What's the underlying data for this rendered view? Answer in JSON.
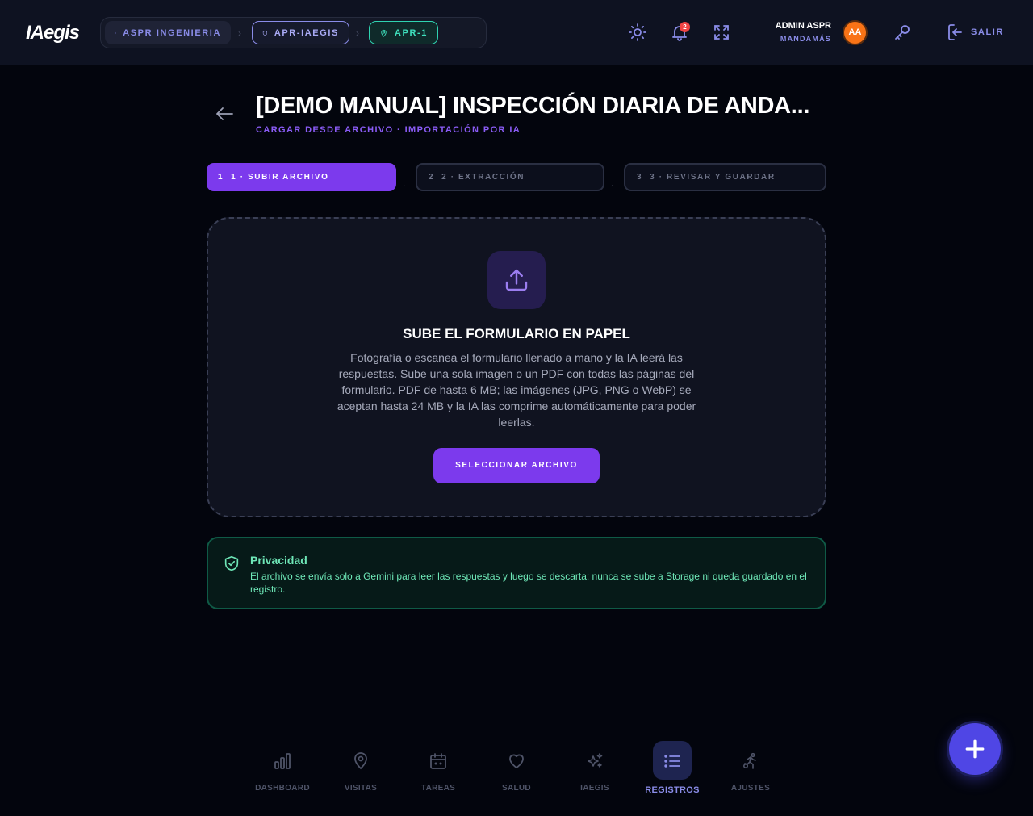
{
  "header": {
    "logo": "IAegis",
    "breadcrumbs": [
      {
        "label": "ASPR INGENIERIA",
        "icon": "building-icon"
      },
      {
        "label": "APR-IAEGIS",
        "icon": "shield-icon"
      },
      {
        "label": "APR-1",
        "icon": "map-pin-icon"
      }
    ],
    "notifications_count": "2",
    "user": {
      "name": "ADMIN ASPR",
      "role": "MANDAMÁS",
      "initials": "AA"
    },
    "logout_label": "SALIR"
  },
  "page": {
    "title": "[DEMO MANUAL] INSPECCIÓN DIARIA DE ANDA...",
    "subtitle": "CARGAR DESDE ARCHIVO · IMPORTACIÓN POR IA"
  },
  "steps": [
    {
      "num": "1",
      "label": "1 · SUBIR ARCHIVO",
      "active": true
    },
    {
      "num": "2",
      "label": "2 · EXTRACCIÓN",
      "active": false
    },
    {
      "num": "3",
      "label": "3 · REVISAR Y GUARDAR",
      "active": false
    }
  ],
  "step_separator": ".",
  "upload": {
    "heading": "SUBE EL FORMULARIO EN PAPEL",
    "description": "Fotografía o escanea el formulario llenado a mano y la IA leerá las respuestas. Sube una sola imagen o un PDF con todas las páginas del formulario. PDF de hasta 6 MB; las imágenes (JPG, PNG o WebP) se aceptan hasta 24 MB y la IA las comprime automáticamente para poder leerlas.",
    "button_label": "SELECCIONAR ARCHIVO"
  },
  "privacy": {
    "title": "Privacidad",
    "text": "El archivo se envía solo a Gemini para leer las respuestas y luego se descarta: nunca se sube a Storage ni queda guardado en el registro."
  },
  "bottom_nav": [
    {
      "label": "DASHBOARD",
      "icon": "bar-chart-icon"
    },
    {
      "label": "VISITAS",
      "icon": "map-pin-icon"
    },
    {
      "label": "TAREAS",
      "icon": "calendar-icon"
    },
    {
      "label": "SALUD",
      "icon": "heart-icon"
    },
    {
      "label": "IAEGIS",
      "icon": "sparkles-icon"
    },
    {
      "label": "REGISTROS",
      "icon": "list-icon",
      "active": true
    },
    {
      "label": "AJUSTES",
      "icon": "settings-runner-icon"
    }
  ],
  "colors": {
    "accent": "#7c3aed",
    "indigo": "#8a8ce8",
    "success": "#6ee7b7",
    "background": "#03050d",
    "badge": "#ef4444",
    "avatar": "#f97316"
  }
}
